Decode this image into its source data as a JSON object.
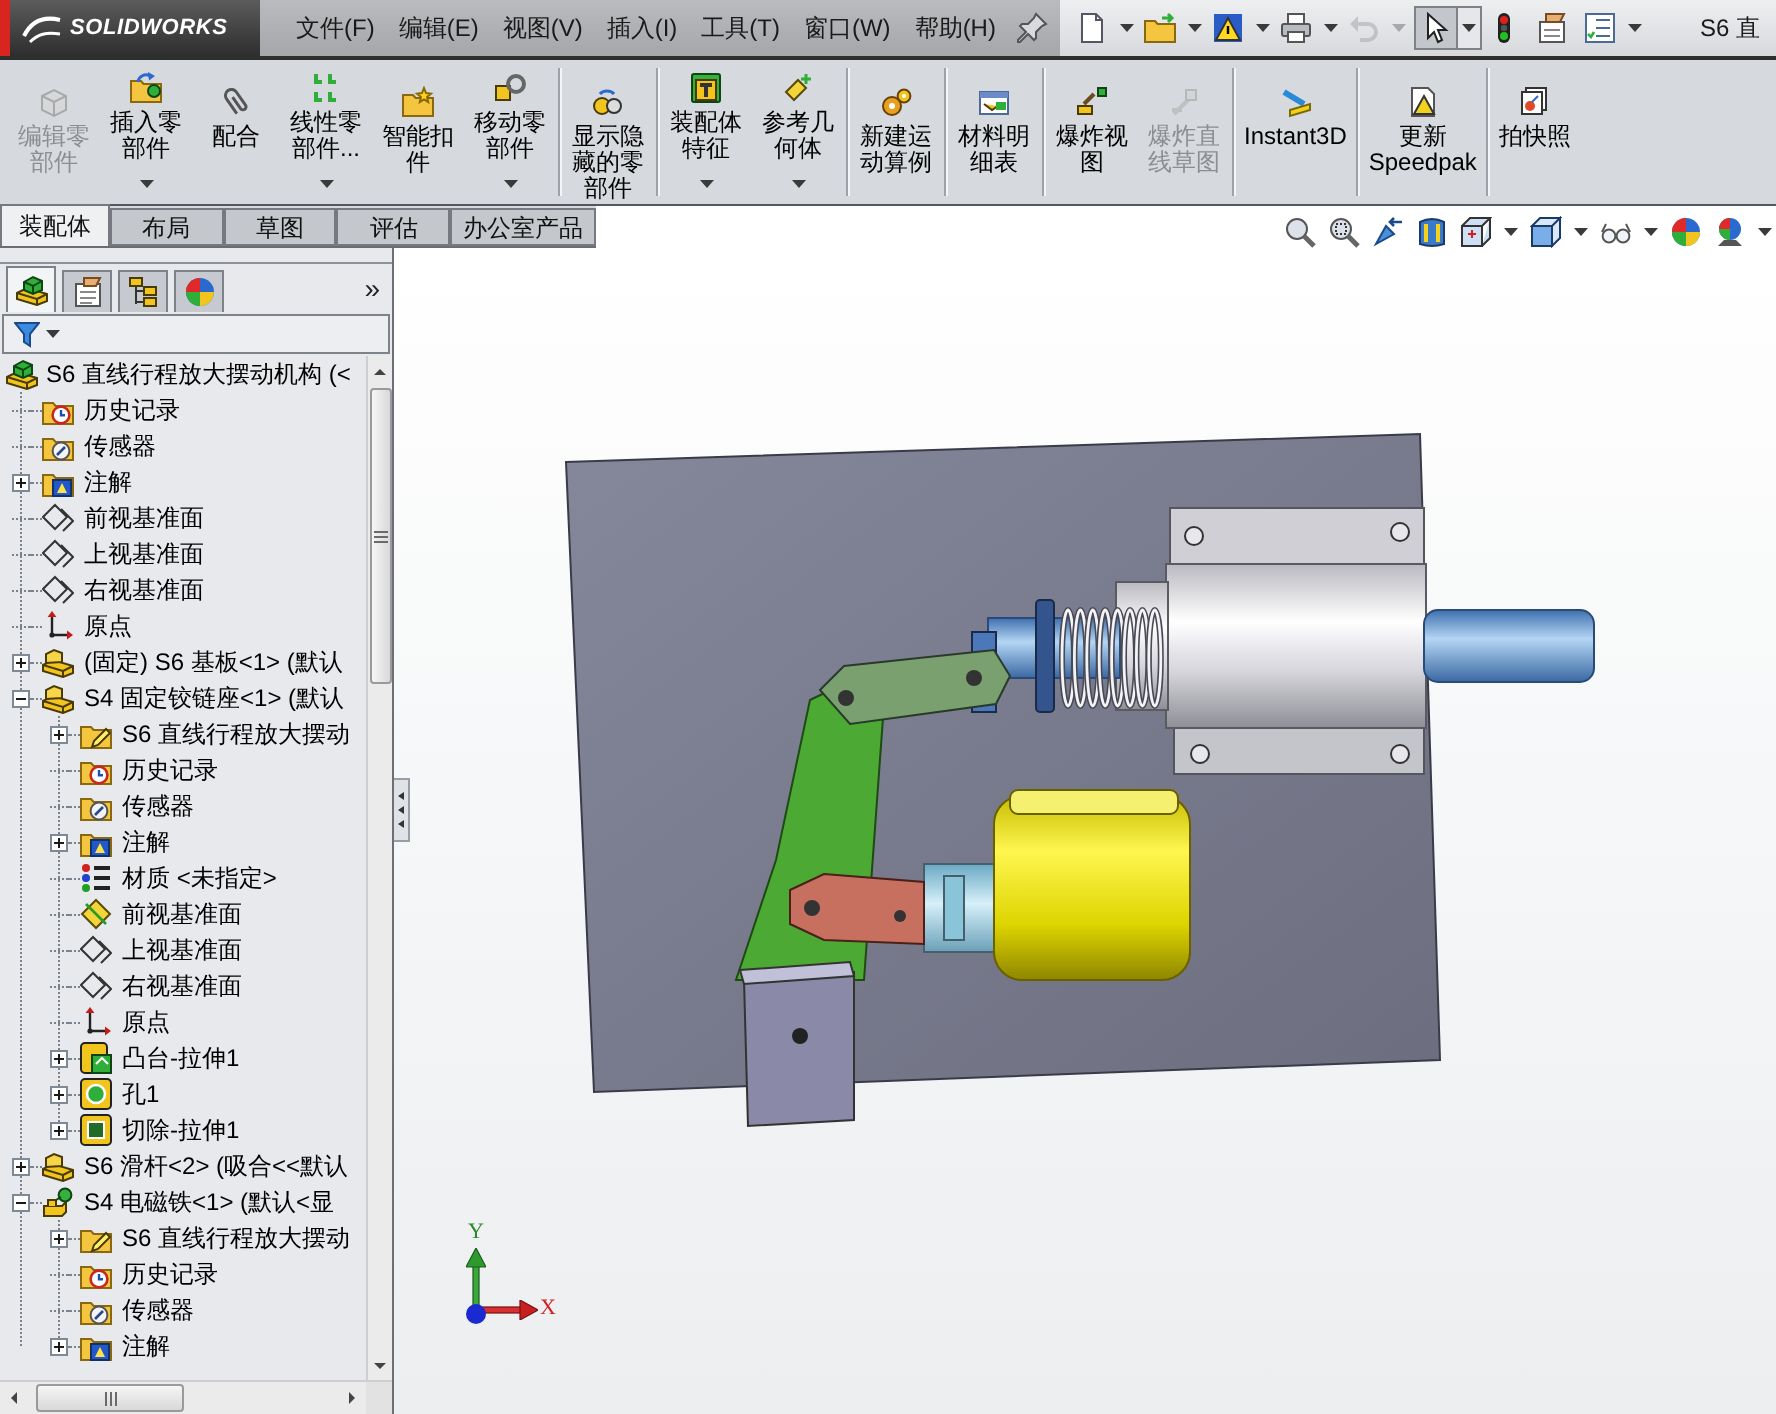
{
  "app_bar": {
    "logo": "SOLIDWORKS",
    "menu": [
      "文件(F)",
      "编辑(E)",
      "视图(V)",
      "插入(I)",
      "工具(T)",
      "窗口(W)",
      "帮助(H)"
    ],
    "quick_access": [
      {
        "kind": "new",
        "dropdown": true,
        "disabled": false,
        "pressed": false
      },
      {
        "kind": "open",
        "dropdown": true,
        "disabled": false,
        "pressed": false
      },
      {
        "kind": "rebuild",
        "dropdown": true,
        "disabled": false,
        "pressed": false
      },
      {
        "kind": "print",
        "dropdown": true,
        "disabled": false,
        "pressed": false
      },
      {
        "kind": "undo",
        "dropdown": true,
        "disabled": true,
        "pressed": false
      },
      {
        "kind": "select",
        "dropdown": true,
        "disabled": false,
        "pressed": true
      },
      {
        "kind": "traffic-light",
        "dropdown": false,
        "disabled": false,
        "pressed": false
      },
      {
        "kind": "options",
        "dropdown": false,
        "disabled": false,
        "pressed": false
      },
      {
        "kind": "properties",
        "dropdown": true,
        "disabled": false,
        "pressed": false
      }
    ],
    "title": "S6 直"
  },
  "command_manager": {
    "groups": [
      {
        "buttons": [
          {
            "kind": "edit-component",
            "label": "编辑零部件",
            "disabled": true,
            "dropdown": false
          },
          {
            "kind": "insert-component",
            "label": "插入零部件",
            "disabled": false,
            "dropdown": true
          },
          {
            "kind": "mate",
            "label": "配合",
            "disabled": false,
            "dropdown": false
          },
          {
            "kind": "linear-pattern",
            "label": "线性零部件...",
            "disabled": false,
            "dropdown": true
          },
          {
            "kind": "smart-fastener",
            "label": "智能扣件",
            "disabled": false,
            "dropdown": false
          },
          {
            "kind": "move-component",
            "label": "移动零部件",
            "disabled": false,
            "dropdown": true
          }
        ]
      },
      {
        "buttons": [
          {
            "kind": "show-hidden",
            "label": "显示隐藏的零部件",
            "disabled": false,
            "dropdown": false
          }
        ]
      },
      {
        "buttons": [
          {
            "kind": "assembly-features",
            "label": "装配体特征",
            "disabled": false,
            "dropdown": true
          },
          {
            "kind": "reference-geometry",
            "label": "参考几何体",
            "disabled": false,
            "dropdown": true
          }
        ]
      },
      {
        "buttons": [
          {
            "kind": "motion-study",
            "label": "新建运动算例",
            "disabled": false,
            "dropdown": false
          }
        ]
      },
      {
        "buttons": [
          {
            "kind": "bom",
            "label": "材料明细表",
            "disabled": false,
            "dropdown": false
          }
        ]
      },
      {
        "buttons": [
          {
            "kind": "exploded-view",
            "label": "爆炸视图",
            "disabled": false,
            "dropdown": false
          },
          {
            "kind": "explode-line",
            "label": "爆炸直线草图",
            "disabled": true,
            "dropdown": false
          }
        ]
      },
      {
        "buttons": [
          {
            "kind": "instant3d",
            "label": "Instant3D",
            "disabled": false,
            "dropdown": false
          }
        ]
      },
      {
        "buttons": [
          {
            "kind": "speedpak",
            "label": "更新 Speedpak",
            "disabled": false,
            "dropdown": false
          }
        ]
      },
      {
        "buttons": [
          {
            "kind": "snapshot",
            "label": "拍快照",
            "disabled": false,
            "dropdown": false
          }
        ]
      }
    ]
  },
  "tabs": [
    {
      "label": "装配体",
      "selected": true
    },
    {
      "label": "布局",
      "selected": false
    },
    {
      "label": "草图",
      "selected": false
    },
    {
      "label": "评估",
      "selected": false
    },
    {
      "label": "办公室产品",
      "selected": false
    }
  ],
  "view_toolbar": [
    {
      "kind": "zoom-fit",
      "dropdown": false
    },
    {
      "kind": "zoom-area",
      "dropdown": false
    },
    {
      "kind": "previous-view",
      "dropdown": false
    },
    {
      "kind": "section-view",
      "dropdown": false
    },
    {
      "kind": "view-orientation",
      "dropdown": true
    },
    {
      "kind": "display-style",
      "dropdown": true
    },
    {
      "kind": "hide-show",
      "dropdown": true
    },
    {
      "kind": "appearance",
      "dropdown": false
    },
    {
      "kind": "scene",
      "dropdown": true
    }
  ],
  "feature_manager": {
    "tabs": [
      {
        "kind": "feature-tree",
        "selected": true
      },
      {
        "kind": "property-manager",
        "selected": false
      },
      {
        "kind": "configuration-manager",
        "selected": false
      },
      {
        "kind": "display-manager",
        "selected": false
      }
    ],
    "overflow": "»",
    "tree": [
      {
        "label": "S6 直线行程放大摆动机构 (<",
        "kind": "assembly",
        "children": [
          {
            "label": "历史记录",
            "kind": "history"
          },
          {
            "label": "传感器",
            "kind": "sensor"
          },
          {
            "label": "注解",
            "kind": "annotation",
            "expanded": false
          },
          {
            "label": "前视基准面",
            "kind": "plane"
          },
          {
            "label": "上视基准面",
            "kind": "plane"
          },
          {
            "label": "右视基准面",
            "kind": "plane"
          },
          {
            "label": "原点",
            "kind": "origin"
          },
          {
            "label": "(固定) S6 基板<1> (默认",
            "kind": "part",
            "expanded": false
          },
          {
            "label": "S4 固定铰链座<1> (默认",
            "kind": "part",
            "expanded": true,
            "children": [
              {
                "label": "S6 直线行程放大摆动",
                "kind": "reference-folder",
                "expanded": false
              },
              {
                "label": "历史记录",
                "kind": "history"
              },
              {
                "label": "传感器",
                "kind": "sensor"
              },
              {
                "label": "注解",
                "kind": "annotation",
                "expanded": false
              },
              {
                "label": "材质 <未指定>",
                "kind": "material"
              },
              {
                "label": "前视基准面",
                "kind": "plane-shown"
              },
              {
                "label": "上视基准面",
                "kind": "plane"
              },
              {
                "label": "右视基准面",
                "kind": "plane"
              },
              {
                "label": "原点",
                "kind": "origin"
              },
              {
                "label": "凸台-拉伸1",
                "kind": "boss",
                "expanded": false
              },
              {
                "label": "孔1",
                "kind": "hole",
                "expanded": false
              },
              {
                "label": "切除-拉伸1",
                "kind": "cut",
                "expanded": false
              }
            ]
          },
          {
            "label": "S6 滑杆<2> (吸合<<默认",
            "kind": "part",
            "expanded": false
          },
          {
            "label": "S4 电磁铁<1> (默认<显",
            "kind": "part-pinned",
            "expanded": true,
            "children": [
              {
                "label": "S6 直线行程放大摆动",
                "kind": "reference-folder",
                "expanded": false
              },
              {
                "label": "历史记录",
                "kind": "history"
              },
              {
                "label": "传感器",
                "kind": "sensor"
              },
              {
                "label": "注解",
                "kind": "annotation",
                "expanded": false
              }
            ]
          }
        ]
      }
    ]
  },
  "triad": {
    "y_label": "Y",
    "x_label": "X"
  }
}
